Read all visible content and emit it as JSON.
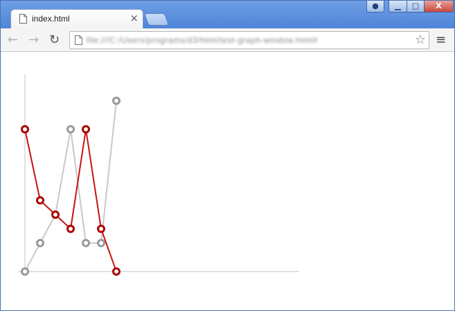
{
  "browser": {
    "tab_title": "index.html",
    "tab_close": "×",
    "url": "file:///C:/Users/programs/d3/html/test-graph-window.html#",
    "icons": {
      "back": "back-arrow-icon",
      "forward": "forward-arrow-icon",
      "reload": "reload-icon",
      "bookmark": "star-icon",
      "menu": "hamburger-menu-icon"
    },
    "glyphs": {
      "back": "←",
      "forward": "→",
      "reload": "↻",
      "bookmark": "☆",
      "menu": "≡",
      "minimize": "▁",
      "maximize": "□",
      "close": "X",
      "user": "●"
    }
  },
  "chart_data": {
    "type": "line",
    "title": "",
    "xlabel": "",
    "ylabel": "",
    "x": [
      0,
      1,
      2,
      3,
      4,
      5,
      6
    ],
    "xlim": [
      0,
      18
    ],
    "ylim": [
      0,
      13
    ],
    "grid": false,
    "series": [
      {
        "color": "#cc1111",
        "marker_color": "#aa0000",
        "values": [
          10,
          5,
          4,
          3,
          10,
          3,
          0
        ]
      },
      {
        "color": "#c8c8c8",
        "marker_color": "#999999",
        "values": [
          0,
          2,
          4,
          10,
          2,
          2,
          12
        ]
      }
    ]
  }
}
